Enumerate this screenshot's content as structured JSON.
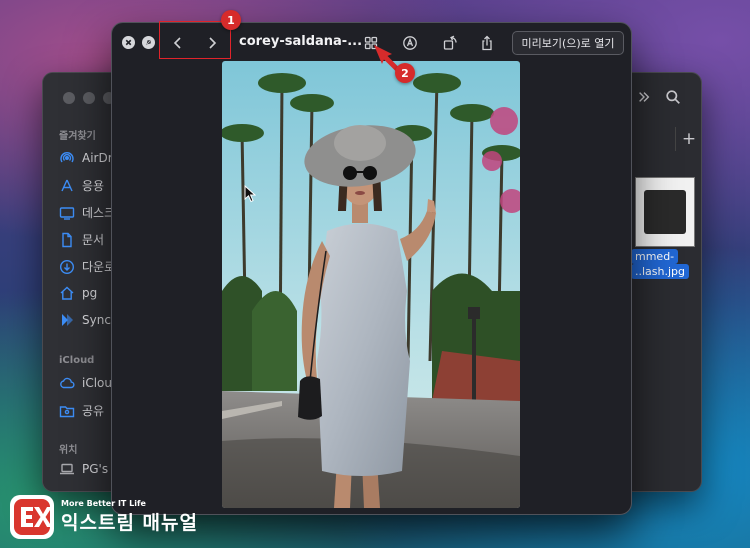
{
  "finder": {
    "sidebar": {
      "favorites_header": "즐겨찾기",
      "favorites": [
        {
          "label": "AirDr",
          "icon": "airdrop-icon"
        },
        {
          "label": "응용",
          "icon": "applications-icon"
        },
        {
          "label": "데스크",
          "icon": "desktop-icon"
        },
        {
          "label": "문서",
          "icon": "document-icon"
        },
        {
          "label": "다운로",
          "icon": "downloads-icon"
        },
        {
          "label": "pg",
          "icon": "home-icon"
        },
        {
          "label": "Sync",
          "icon": "sync-icon"
        }
      ],
      "icloud_header": "iCloud",
      "icloud": [
        {
          "label": "iClou",
          "icon": "cloud-icon"
        },
        {
          "label": "공유",
          "icon": "shared-folder-icon"
        }
      ],
      "locations_header": "위치",
      "locations": [
        {
          "label": "PG's",
          "icon": "laptop-icon"
        }
      ]
    },
    "file": {
      "name_line1": "mmed-",
      "name_line2": "..lash.jpg"
    }
  },
  "quicklook": {
    "title": "corey-saldana-...",
    "open_with_label": "미리보기(으)로 열기"
  },
  "annotations": {
    "badge1": "1",
    "badge2": "2",
    "color": "#d62b2b"
  },
  "logo": {
    "tagline": "More Better IT Life",
    "name": "익스트림 매뉴얼"
  }
}
